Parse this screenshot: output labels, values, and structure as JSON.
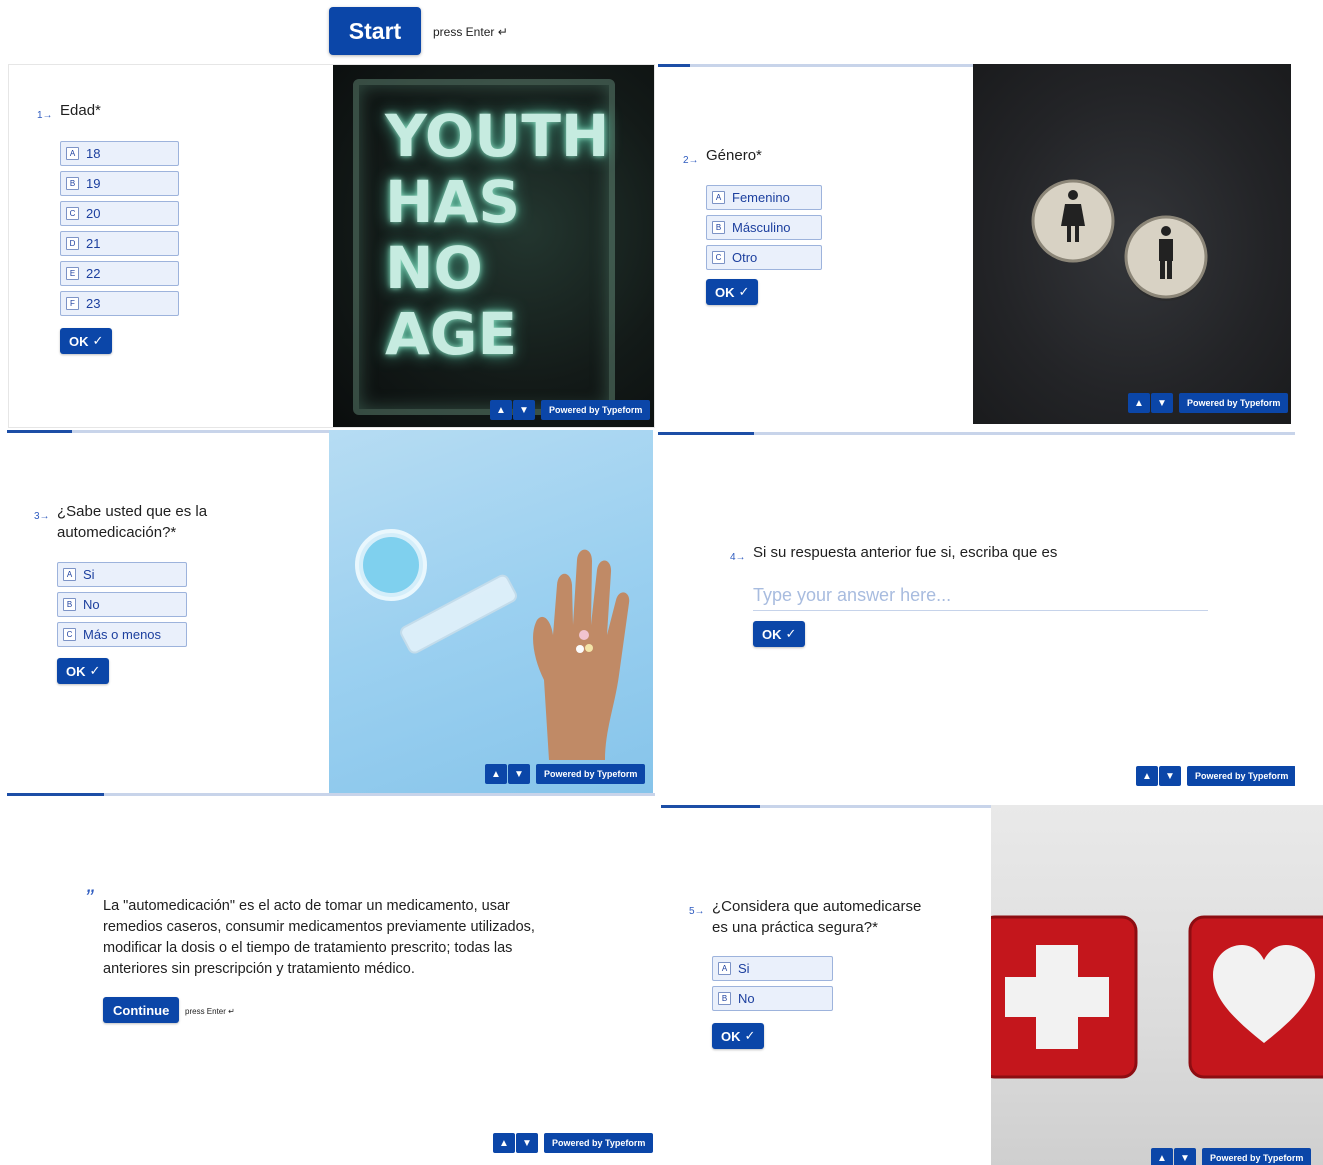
{
  "start": {
    "label": "Start",
    "hint": "press Enter ↵"
  },
  "nav": {
    "up_icon": "chevron-up-icon",
    "down_icon": "chevron-down-icon",
    "powered": "Powered by Typeform"
  },
  "q1": {
    "number": "1→",
    "text": "Edad*",
    "choices": [
      {
        "key": "A",
        "label": "18"
      },
      {
        "key": "B",
        "label": "19"
      },
      {
        "key": "C",
        "label": "20"
      },
      {
        "key": "D",
        "label": "21"
      },
      {
        "key": "E",
        "label": "22"
      },
      {
        "key": "F",
        "label": "23"
      }
    ],
    "ok": "OK",
    "ok_check": "✓",
    "neon": [
      "YOUTH",
      "HAS",
      "NO",
      "AGE"
    ]
  },
  "q2": {
    "number": "2→",
    "text": "Género*",
    "choices": [
      {
        "key": "A",
        "label": "Femenino"
      },
      {
        "key": "B",
        "label": "Másculino"
      },
      {
        "key": "C",
        "label": "Otro"
      }
    ],
    "ok": "OK",
    "ok_check": "✓"
  },
  "q3": {
    "number": "3→",
    "text_line1": "¿Sabe usted que es la",
    "text_line2": "automedicación?*",
    "choices": [
      {
        "key": "A",
        "label": "Si"
      },
      {
        "key": "B",
        "label": "No"
      },
      {
        "key": "C",
        "label": "Más o menos"
      }
    ],
    "ok": "OK",
    "ok_check": "✓"
  },
  "q4": {
    "number": "4→",
    "text": "Si su respuesta anterior fue si, escriba que es",
    "placeholder": "Type your answer here...",
    "ok": "OK",
    "ok_check": "✓"
  },
  "statement": {
    "quote_mark": "”",
    "line1": "La \"automedicación\" es el acto de tomar un medicamento, usar",
    "line2": "remedios caseros, consumir medicamentos previamente utilizados,",
    "line3": "modificar la dosis o el tiempo de tratamiento prescrito; todas las",
    "line4": "anteriores sin prescripción y tratamiento médico.",
    "continue": "Continue",
    "hint": "press Enter ↵"
  },
  "q5": {
    "number": "5→",
    "text_line1": "¿Considera que automedicarse",
    "text_line2": "es una práctica segura?*",
    "choices": [
      {
        "key": "A",
        "label": "Si"
      },
      {
        "key": "B",
        "label": "No"
      }
    ],
    "ok": "OK",
    "ok_check": "✓"
  },
  "colors": {
    "brand": "#0b46a8",
    "choice_bg": "#eaf0fb",
    "choice_border": "#9db3dc",
    "progress": "#1c4ea6"
  }
}
